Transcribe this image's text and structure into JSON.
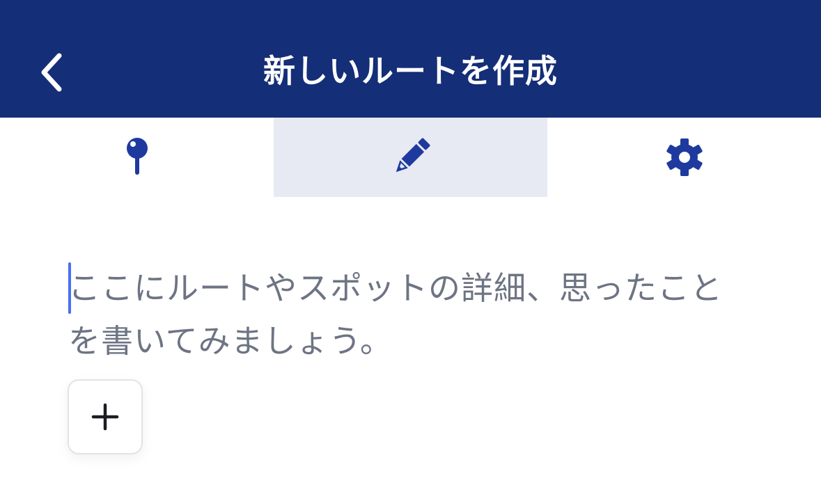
{
  "header": {
    "title": "新しいルートを作成",
    "back_icon": "chevron-left-icon",
    "background_color": "#142e77"
  },
  "tabs": [
    {
      "icon": "map-pin-icon",
      "active": false
    },
    {
      "icon": "pencil-icon",
      "active": true
    },
    {
      "icon": "gear-icon",
      "active": false
    }
  ],
  "editor": {
    "placeholder": "ここにルートやスポットの詳細、思ったことを書いてみましょう。"
  },
  "add_button": {
    "icon": "plus-icon"
  },
  "colors": {
    "accent": "#1e3a9e",
    "active_tab_bg": "#e7e9f3",
    "caret": "#4a6ef0",
    "placeholder_text": "#6d7483"
  }
}
